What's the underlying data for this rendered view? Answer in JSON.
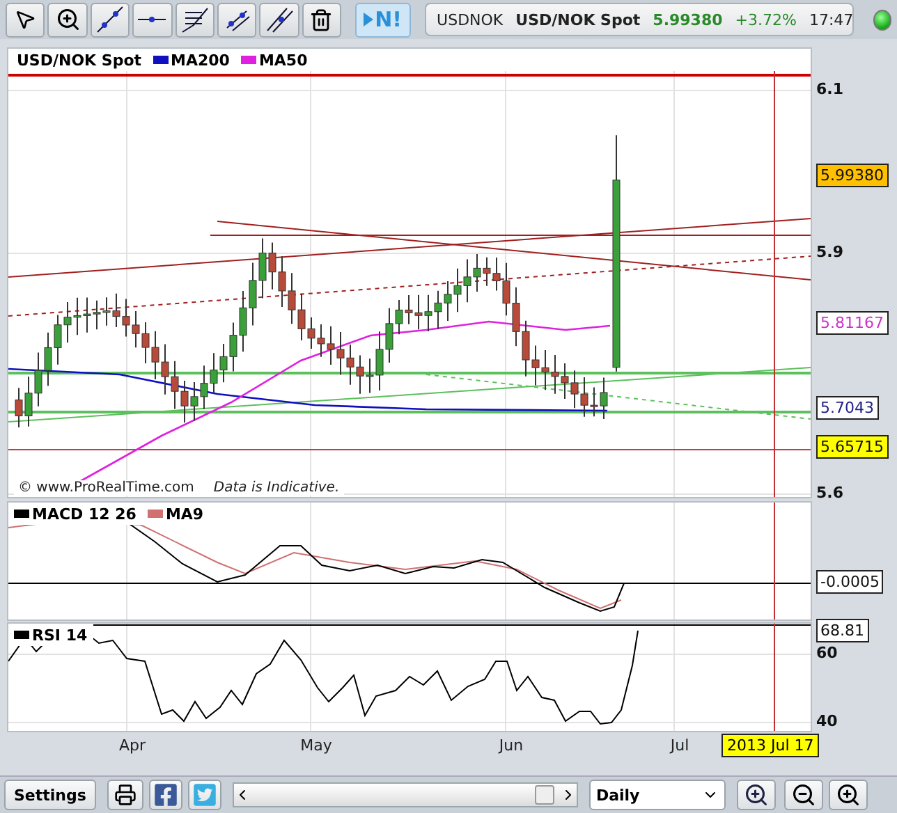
{
  "toolbar": {
    "news_button": "N!"
  },
  "quote": {
    "symbol": "USDNOK",
    "name": "USD/NOK Spot",
    "price": "5.99380",
    "change": "+3.72%",
    "time": "17:47",
    "online": true
  },
  "main_chart": {
    "legend": [
      {
        "label": "USD/NOK Spot"
      },
      {
        "label": "MA200",
        "color": "#1010c0"
      },
      {
        "label": "MA50",
        "color": "#e020e0"
      }
    ],
    "axis": [
      {
        "text": "6.1",
        "kind": "tick"
      },
      {
        "text": "5.99380",
        "kind": "last"
      },
      {
        "text": "5.9",
        "kind": "tick"
      },
      {
        "text": "5.81167",
        "kind": "ma50"
      },
      {
        "text": "5.7043",
        "kind": "ma200"
      },
      {
        "text": "5.65715",
        "kind": "line"
      },
      {
        "text": "5.6",
        "kind": "tick"
      }
    ],
    "credit": "©  www.ProRealTime.com",
    "note": "Data is Indicative."
  },
  "macd": {
    "legend": [
      {
        "label": "MACD 12 26",
        "color": "#000000"
      },
      {
        "label": "MA9",
        "color": "#d07070"
      }
    ],
    "axis": [
      {
        "text": "-0.0005",
        "kind": "value"
      }
    ]
  },
  "rsi": {
    "legend": [
      {
        "label": "RSI 14",
        "color": "#000000"
      }
    ],
    "axis": [
      {
        "text": "68.81",
        "kind": "value"
      },
      {
        "text": "60",
        "kind": "tick"
      },
      {
        "text": "40",
        "kind": "tick"
      }
    ]
  },
  "x_axis": {
    "labels": [
      "Apr",
      "May",
      "Jun",
      "Jul"
    ],
    "cursor_date": "2013 Jul 17"
  },
  "bottom_bar": {
    "settings": "Settings",
    "period": "Daily"
  }
}
